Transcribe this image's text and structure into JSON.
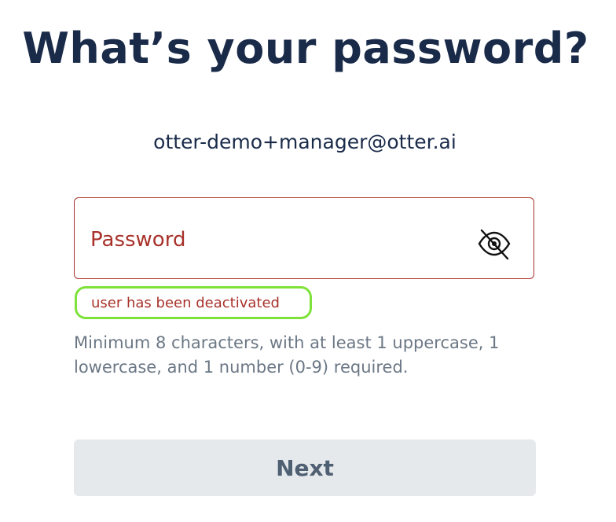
{
  "header": {
    "title": "What’s your password?"
  },
  "account": {
    "email": "otter-demo+manager@otter.ai"
  },
  "password_field": {
    "placeholder": "Password",
    "value": "",
    "toggle_icon": "eye-off-icon"
  },
  "error": {
    "message": "user has been deactivated"
  },
  "hint": {
    "text": "Minimum 8 characters, with at least 1 uppercase, 1 lowercase, and 1 number (0-9) required."
  },
  "actions": {
    "next_label": "Next"
  },
  "colors": {
    "title": "#1a2b4a",
    "error": "#a8322a",
    "highlight": "#7ee23a",
    "hint": "#6b7785",
    "button_bg": "#e6e9ec",
    "button_text": "#4f6073"
  }
}
